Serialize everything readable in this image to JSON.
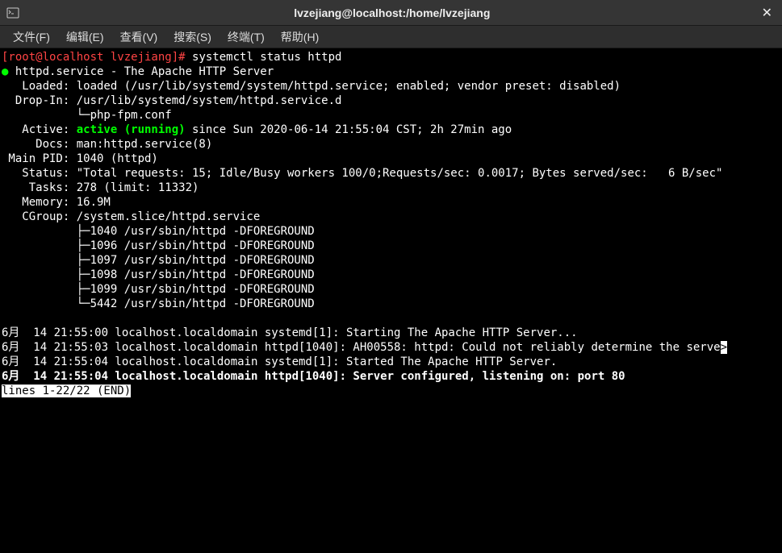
{
  "titlebar": {
    "title": "lvzejiang@localhost:/home/lvzejiang"
  },
  "menubar": {
    "file": "文件(F)",
    "edit": "编辑(E)",
    "view": "查看(V)",
    "search": "搜索(S)",
    "terminal": "终端(T)",
    "help": "帮助(H)"
  },
  "terminal": {
    "prompt": "[root@localhost lvzejiang]# ",
    "command": "systemctl status httpd",
    "service_name": "httpd.service - The Apache HTTP Server",
    "loaded": "   Loaded: loaded (/usr/lib/systemd/system/httpd.service; enabled; vendor preset: disabled)",
    "dropin": "  Drop-In: /usr/lib/systemd/system/httpd.service.d",
    "dropin_file": "           └─php-fpm.conf",
    "active_label": "   Active: ",
    "active_status": "active (running)",
    "active_since": " since Sun 2020-06-14 21:55:04 CST; 2h 27min ago",
    "docs": "     Docs: man:httpd.service(8)",
    "mainpid": " Main PID: 1040 (httpd)",
    "status": "   Status: \"Total requests: 15; Idle/Busy workers 100/0;Requests/sec: 0.0017; Bytes served/sec:   6 B/sec\"",
    "tasks": "    Tasks: 278 (limit: 11332)",
    "memory": "   Memory: 16.9M",
    "cgroup": "   CGroup: /system.slice/httpd.service",
    "proc1": "           ├─1040 /usr/sbin/httpd -DFOREGROUND",
    "proc2": "           ├─1096 /usr/sbin/httpd -DFOREGROUND",
    "proc3": "           ├─1097 /usr/sbin/httpd -DFOREGROUND",
    "proc4": "           ├─1098 /usr/sbin/httpd -DFOREGROUND",
    "proc5": "           ├─1099 /usr/sbin/httpd -DFOREGROUND",
    "proc6": "           └─5442 /usr/sbin/httpd -DFOREGROUND",
    "log1": "6月  14 21:55:00 localhost.localdomain systemd[1]: Starting The Apache HTTP Server...",
    "log2a": "6月  14 21:55:03 localhost.localdomain httpd[1040]: AH00558: httpd: Could not reliably determine the serve",
    "log2b": ">",
    "log3": "6月  14 21:55:04 localhost.localdomain systemd[1]: Started The Apache HTTP Server.",
    "log4": "6月  14 21:55:04 localhost.localdomain httpd[1040]: Server configured, listening on: port 80",
    "pager": "lines 1-22/22 (END)"
  }
}
